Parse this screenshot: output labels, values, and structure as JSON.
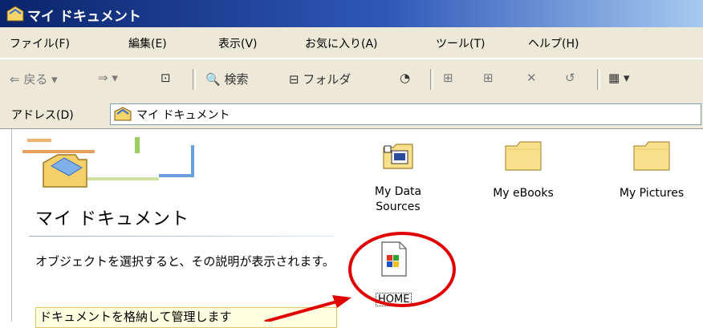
{
  "window": {
    "title": "マイ ドキュメント"
  },
  "menu": [
    {
      "label": "ファイル(F)"
    },
    {
      "label": "編集(E)"
    },
    {
      "label": "表示(V)"
    },
    {
      "label": "お気に入り(A)"
    },
    {
      "label": "ツール(T)"
    },
    {
      "label": "ヘルプ(H)"
    }
  ],
  "toolbar": {
    "back_label": "戻る",
    "search_label": "検索",
    "folders_label": "フォルダ"
  },
  "address": {
    "label": "アドレス(D)",
    "value": "マイ ドキュメント"
  },
  "left_pane": {
    "heading": "マイ ドキュメント",
    "description": "オブジェクトを選択すると、その説明が表示されます。",
    "tip": "ドキュメントを格納して管理します"
  },
  "files": [
    {
      "name": "My Data Sources",
      "icon": "data-sources-icon"
    },
    {
      "name": "My eBooks",
      "icon": "folder-icon"
    },
    {
      "name": "My Pictures",
      "icon": "folder-icon"
    },
    {
      "name": "HOME",
      "icon": "windows-shortcut-icon",
      "selected": true
    }
  ],
  "colors": {
    "titlebar_start": "#0a246a",
    "annotation_red": "#e00000",
    "folder_yellow": "#f8e08c"
  }
}
